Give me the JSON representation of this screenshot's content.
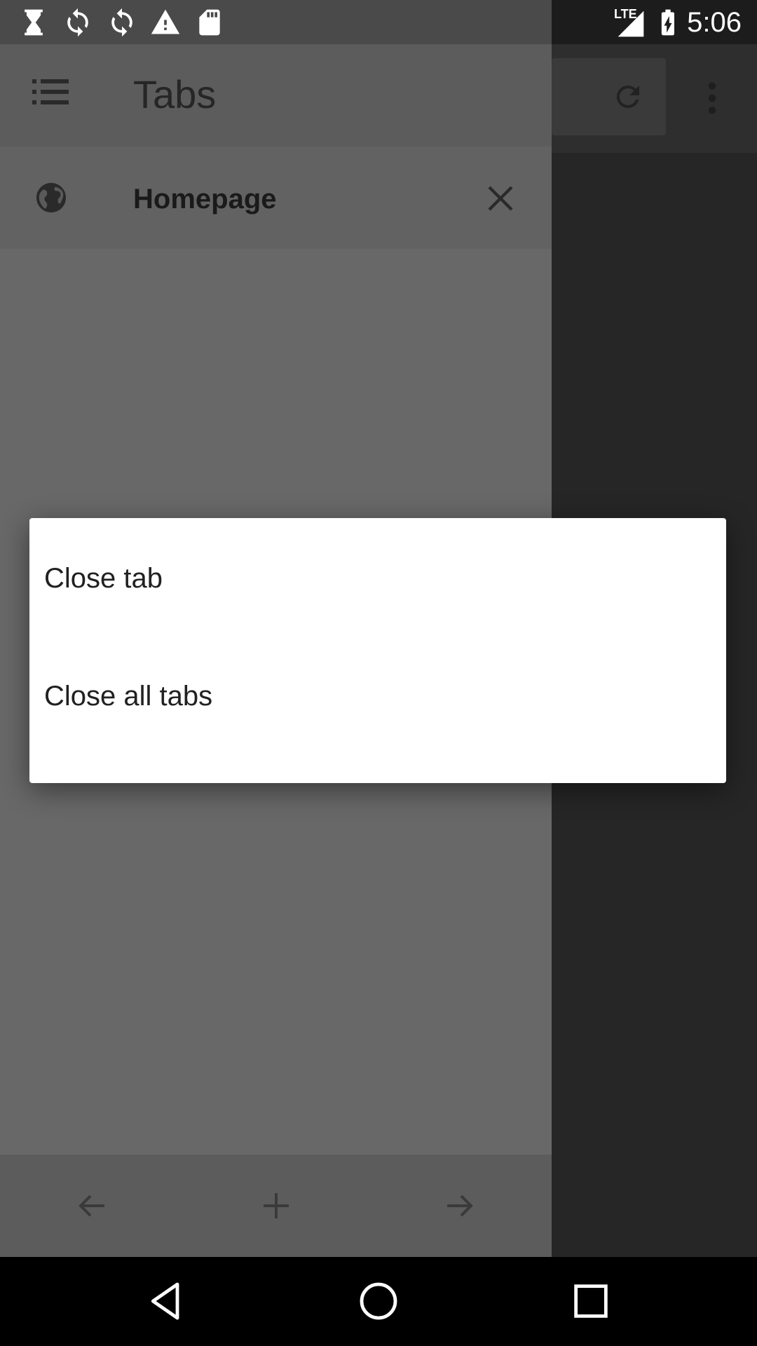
{
  "status_bar": {
    "time": "5:06",
    "network": "LTE",
    "icons": [
      "hourglass-icon",
      "sync-icon",
      "sync-icon",
      "warning-icon",
      "sd-card-icon",
      "signal-icon",
      "battery-charging-icon"
    ]
  },
  "drawer": {
    "title": "Tabs",
    "tabs": [
      {
        "label": "Homepage",
        "icon": "globe-icon"
      }
    ],
    "bottom_buttons": [
      "back-arrow-icon",
      "plus-icon",
      "forward-arrow-icon"
    ]
  },
  "dialog": {
    "items": [
      {
        "label": "Close tab"
      },
      {
        "label": "Close all tabs"
      }
    ]
  },
  "nav_bar": {
    "buttons": [
      "back-triangle-icon",
      "home-circle-icon",
      "recents-square-icon"
    ]
  },
  "colors": {
    "drawer_bg": "#686868",
    "dialog_bg": "#ffffff",
    "text_dark": "#212121"
  }
}
